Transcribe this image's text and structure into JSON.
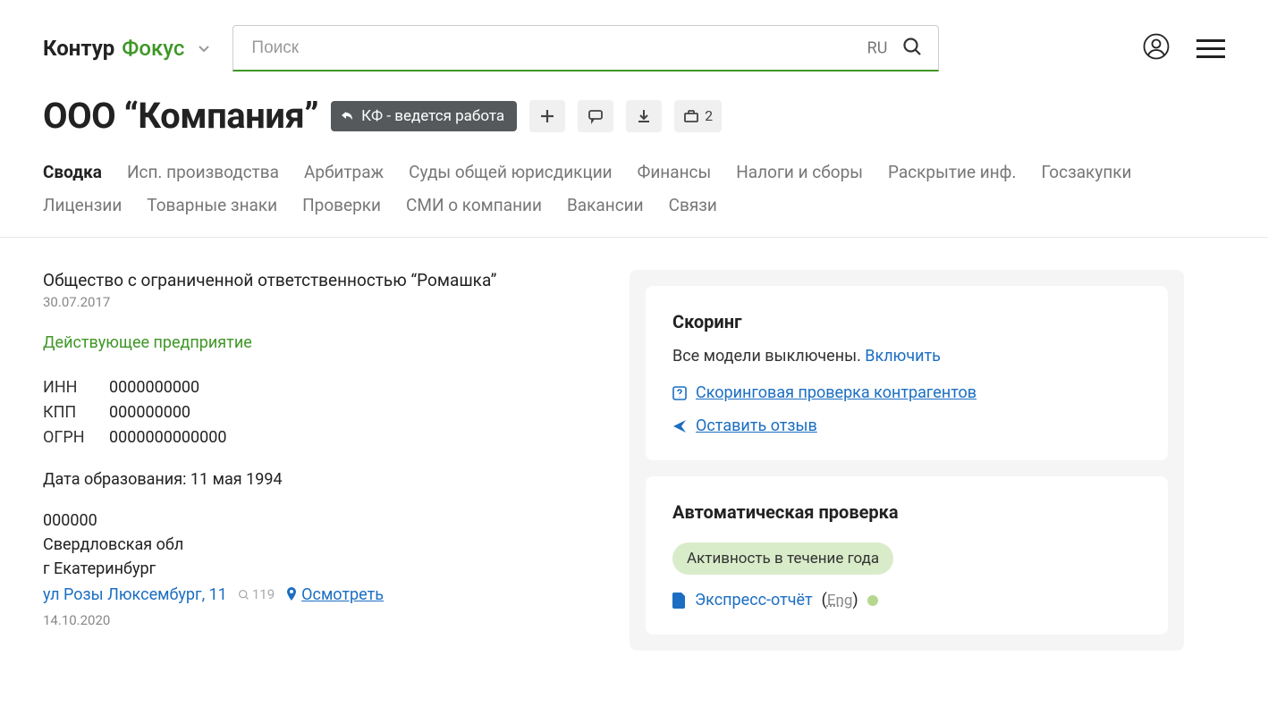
{
  "header": {
    "logo_kontour": "Контур",
    "logo_focus": "Фокус",
    "search_placeholder": "Поиск",
    "search_lang": "RU"
  },
  "title": {
    "company_name": "ООО “Компания”",
    "badge": "КФ - ведется работа",
    "briefcase_count": "2"
  },
  "tabs": [
    "Сводка",
    "Исп. производства",
    "Арбитраж",
    "Суды общей юрисдикции",
    "Финансы",
    "Налоги и сборы",
    "Раскрытие инф.",
    "Госзакупки",
    "Лицензии",
    "Товарные знаки",
    "Проверки",
    "СМИ о компании",
    "Вакансии",
    "Связи"
  ],
  "company": {
    "full_name": "Общество с ограниченной ответственностью “Ромашка”",
    "date_label": "30.07.2017",
    "status": "Действующее предприятие",
    "inn_label": "ИНН",
    "inn": "0000000000",
    "kpp_label": "КПП",
    "kpp": "000000000",
    "ogrn_label": "ОГРН",
    "ogrn": "0000000000000",
    "formation_label": "Дата образования:",
    "formation_date": "11 мая 1994",
    "postal": "000000",
    "region": "Свердловская обл",
    "city": "г Екатеринбург",
    "street": "ул Розы Люксембург, 11",
    "views_count": "119",
    "inspect_label": "Осмотреть",
    "address_date": "14.10.2020"
  },
  "scoring": {
    "title": "Скоринг",
    "text_prefix": "Все модели выключены. ",
    "enable_link": "Включить",
    "check_link": "Скоринговая проверка контрагентов",
    "feedback_link": "Оставить отзыв"
  },
  "auto": {
    "title": "Автоматическая проверка",
    "pill": "Активность в течение года",
    "report": "Экспресс-отчёт",
    "eng": "Eng"
  }
}
